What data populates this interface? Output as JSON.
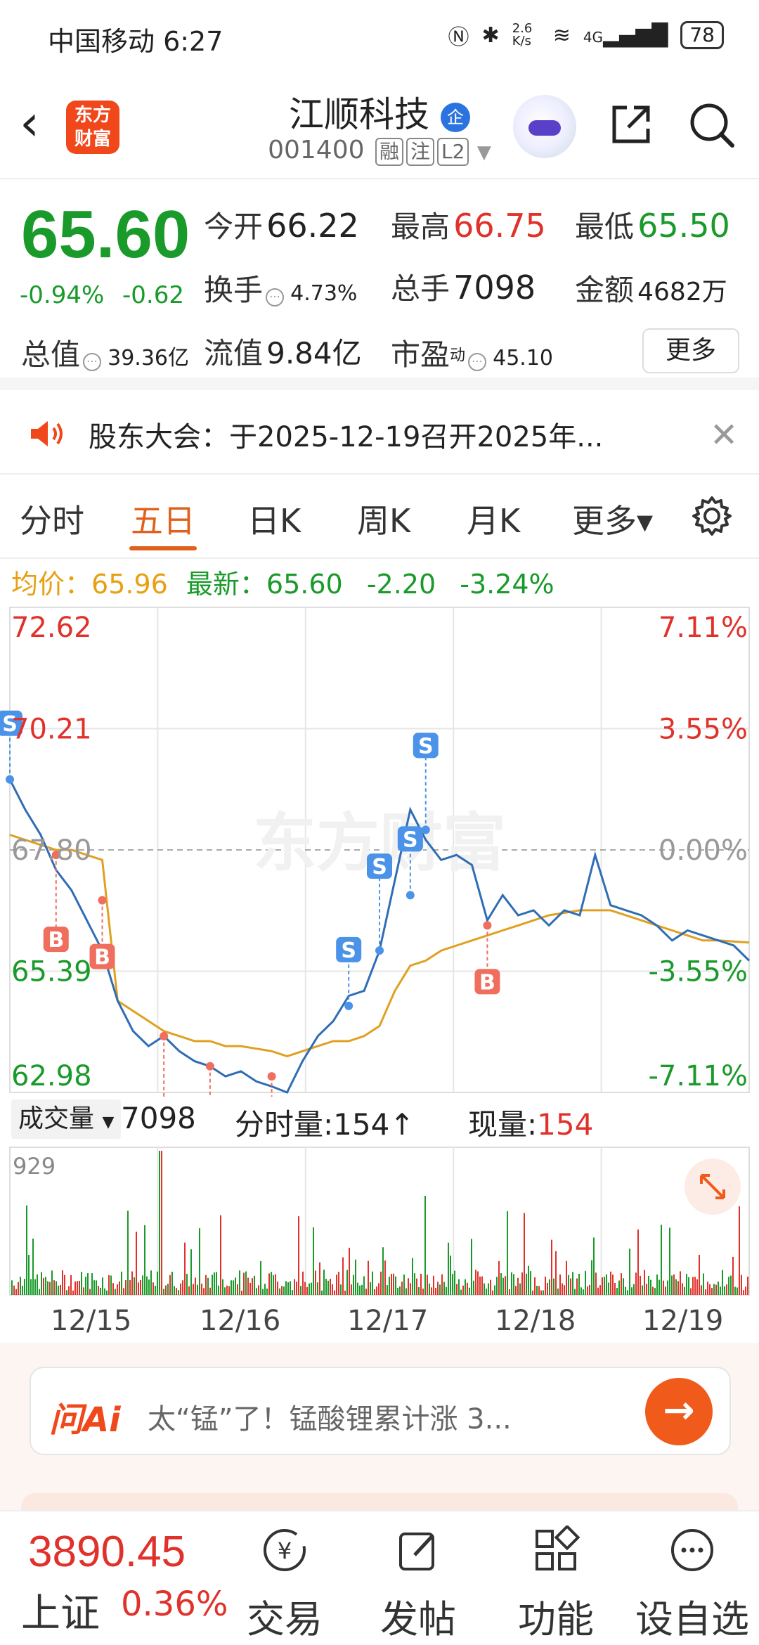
{
  "status_bar": {
    "carrier": "中国移动 6:27",
    "net_speed": "2.6 K/s",
    "signal": "4G",
    "battery": "78"
  },
  "header": {
    "logo": "东方财富",
    "title": "江顺科技",
    "title_badge": "企",
    "code": "001400",
    "tags": [
      "融",
      "注",
      "L2"
    ]
  },
  "quote": {
    "price": "65.60",
    "pct": "-0.94%",
    "chg": "-0.62",
    "open_label": "今开",
    "open": "66.22",
    "high_label": "最高",
    "high": "66.75",
    "low_label": "最低",
    "low": "65.50",
    "turnover_label": "换手",
    "turnover": "4.73%",
    "volume_label": "总手",
    "volume": "7098",
    "amount_label": "金额",
    "amount": "4682万",
    "mktcap_label": "总值",
    "mktcap": "39.36亿",
    "float_label": "流值",
    "float": "9.84亿",
    "pe_label": "市盈",
    "pe_sup": "动",
    "pe": "45.10",
    "more": "更多"
  },
  "notice": {
    "text": "股东大会：于2025-12-19召开2025年..."
  },
  "tabs": [
    {
      "label": "分时",
      "active": false
    },
    {
      "label": "五日",
      "active": true
    },
    {
      "label": "日K",
      "active": false
    },
    {
      "label": "周K",
      "active": false
    },
    {
      "label": "月K",
      "active": false
    },
    {
      "label": "更多▾",
      "active": false
    }
  ],
  "infoline": {
    "avg_label": "均价：",
    "avg": "65.96",
    "latest_label": "最新：",
    "latest": "65.60",
    "chg": "-2.20",
    "pct": "-3.24%"
  },
  "chart_data": {
    "type": "line",
    "title": "",
    "watermark": "东方财富",
    "y_left_labels": [
      "72.62",
      "70.21",
      "67.80",
      "65.39",
      "62.98"
    ],
    "y_right_labels": [
      "7.11%",
      "3.55%",
      "0.00%",
      "-3.55%",
      "-7.11%"
    ],
    "ylim": [
      62.98,
      72.62
    ],
    "x_labels": [
      "12/15",
      "12/16",
      "12/17",
      "12/18",
      "12/19"
    ],
    "series": [
      {
        "values": [
          69.2,
          68.6,
          68.1,
          67.4,
          67.0,
          66.4,
          65.8,
          64.8,
          64.2,
          63.9,
          64.1,
          63.8,
          63.6,
          63.5,
          63.3,
          63.4,
          63.2,
          63.1,
          62.98,
          63.6,
          64.1,
          64.4,
          64.9,
          65.0,
          65.8,
          67.2,
          68.6,
          68.0,
          67.6,
          67.7,
          67.5,
          66.4,
          66.9,
          66.5,
          66.6,
          66.3,
          66.6,
          66.5,
          67.7,
          66.7,
          66.6,
          66.5,
          66.3,
          66.0,
          66.2,
          66.1,
          66.0,
          65.9,
          65.6
        ]
      },
      {
        "values": [
          68.1,
          68.0,
          67.9,
          67.8,
          67.8,
          67.7,
          67.6,
          64.8,
          64.6,
          64.4,
          64.2,
          64.1,
          64.0,
          64.0,
          63.9,
          63.9,
          63.85,
          63.8,
          63.7,
          63.8,
          63.9,
          64.0,
          64.0,
          64.1,
          64.3,
          65.0,
          65.5,
          65.6,
          65.8,
          65.9,
          66.0,
          66.1,
          66.2,
          66.3,
          66.4,
          66.5,
          66.55,
          66.6,
          66.6,
          66.6,
          66.5,
          66.4,
          66.3,
          66.2,
          66.1,
          66.0,
          66.0,
          65.98,
          65.96
        ]
      }
    ],
    "markers": [
      {
        "label": "S",
        "x": 0,
        "y": 69.2,
        "kind": "sell"
      },
      {
        "label": "B",
        "x": 3,
        "y": 67.7,
        "kind": "buy"
      },
      {
        "label": "B",
        "x": 6,
        "y": 66.8,
        "kind": "buy"
      },
      {
        "label": "B",
        "x": 10,
        "y": 64.1,
        "kind": "buy"
      },
      {
        "label": "B",
        "x": 13,
        "y": 63.5,
        "kind": "buy"
      },
      {
        "label": "B",
        "x": 17,
        "y": 63.3,
        "kind": "buy"
      },
      {
        "label": "S",
        "x": 22,
        "y": 64.7,
        "kind": "sell"
      },
      {
        "label": "S",
        "x": 24,
        "y": 65.8,
        "kind": "sell"
      },
      {
        "label": "S",
        "x": 26,
        "y": 66.9,
        "kind": "sell"
      },
      {
        "label": "S",
        "x": 27,
        "y": 68.2,
        "kind": "sell"
      },
      {
        "label": "B",
        "x": 31,
        "y": 66.3,
        "kind": "buy"
      }
    ],
    "volume": {
      "label": "成交量",
      "total": "7098",
      "tick_label": "分时量:154↑",
      "now_label": "现量:",
      "now": "154",
      "ymax_label": "929"
    }
  },
  "ai": {
    "logo": "问Ai",
    "text": "太“锰”了！锰酸锂累计涨 3...",
    "go": "→"
  },
  "bottom_nav": {
    "index_value": "3890.45",
    "index_name": "上证",
    "index_pct": "0.36%",
    "items": [
      {
        "label": "交易",
        "icon": "yen-circle-icon"
      },
      {
        "label": "发帖",
        "icon": "edit-icon"
      },
      {
        "label": "功能",
        "icon": "grid-icon"
      },
      {
        "label": "设自选",
        "icon": "more-icon"
      }
    ]
  },
  "colors": {
    "up": "#e0312b",
    "down": "#1a9a2a",
    "accent": "#e0611b",
    "price_line": "#2f6db5",
    "avg_line": "#e0a020",
    "sell": "#4b93e8",
    "buy": "#ef6e5e"
  }
}
